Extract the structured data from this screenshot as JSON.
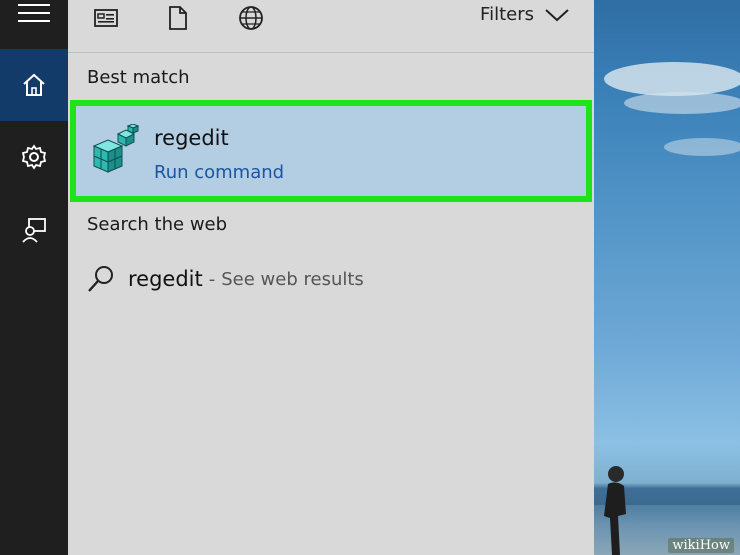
{
  "toolbar": {
    "icons": [
      "apps-icon",
      "document-icon",
      "globe-icon"
    ],
    "filters_label": "Filters"
  },
  "rail": {
    "icons": [
      "hamburger-menu-icon",
      "home-icon",
      "gear-icon",
      "feedback-icon"
    ],
    "active": "home"
  },
  "best_match": {
    "heading": "Best match",
    "result": {
      "name": "regedit",
      "subtitle": "Run command",
      "icon": "registry-editor-icon"
    }
  },
  "search_web": {
    "heading": "Search the web",
    "term": "regedit",
    "separator": "-",
    "hint": "See web results"
  },
  "watermark": "wikiHow",
  "colors": {
    "highlight_border": "#1ee31a",
    "result_bg": "#b3cde3",
    "subtitle_text": "#1a56a0",
    "rail_bg": "#1f1f1f",
    "rail_active": "#123b6a",
    "panel_bg": "#d9d9d9"
  }
}
